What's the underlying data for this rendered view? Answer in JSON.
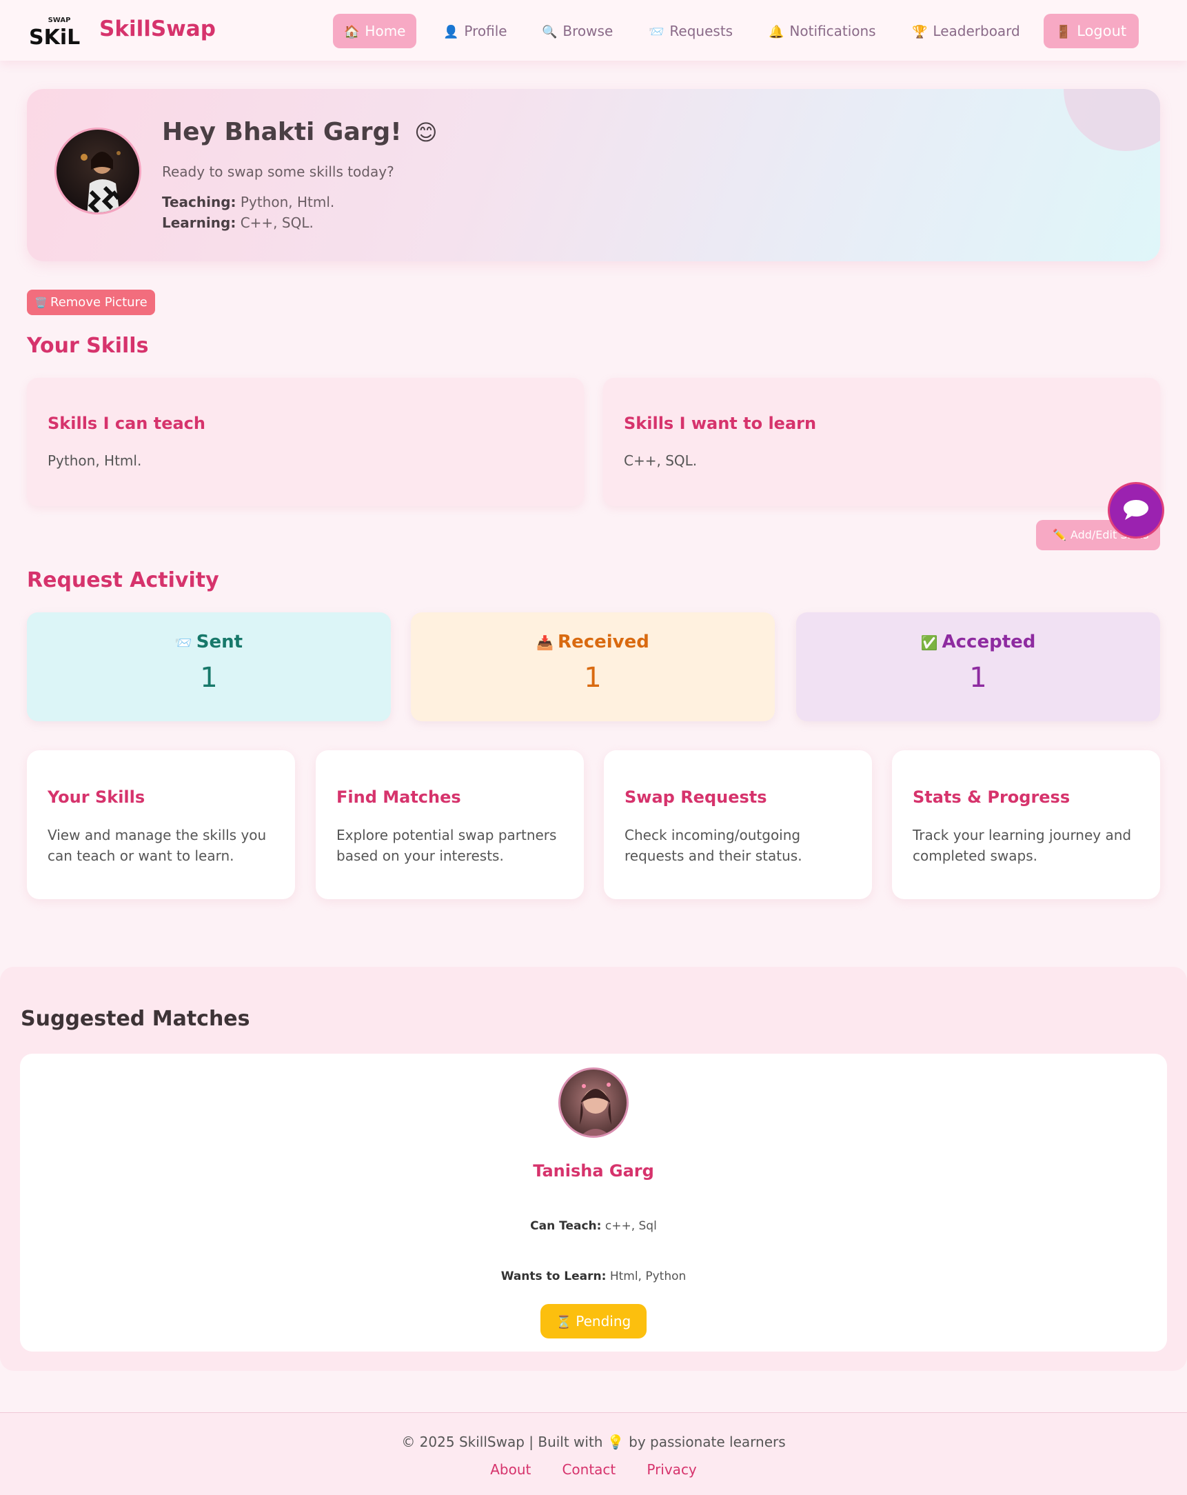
{
  "navbar": {
    "brand": "SkillSwap",
    "logo_text": "SKiL",
    "logo_swap": "SWAP",
    "items": [
      {
        "label": "Home",
        "icon": "🏠"
      },
      {
        "label": "Profile",
        "icon": "👤"
      },
      {
        "label": "Browse",
        "icon": "🔍"
      },
      {
        "label": "Requests",
        "icon": "📨"
      },
      {
        "label": "Notifications",
        "icon": "🔔"
      },
      {
        "label": "Leaderboard",
        "icon": "🏆"
      }
    ],
    "logout": {
      "label": "Logout",
      "icon": "🚪"
    }
  },
  "hero": {
    "title": "Hey Bhakti Garg!",
    "emoji": "😊",
    "subtitle": "Ready to swap some skills today?",
    "teaching_label": "Teaching:",
    "teaching_value": "Python, Html.",
    "learning_label": "Learning:",
    "learning_value": "C++, SQL."
  },
  "remove_picture": {
    "label": "Remove Picture",
    "icon": "🗑️"
  },
  "your_skills": {
    "title": "Your Skills",
    "teach_title": "Skills I can teach",
    "teach_value": "Python, Html.",
    "learn_title": "Skills I want to learn",
    "learn_value": "C++, SQL.",
    "edit_label": "Add/Edit Skills",
    "edit_icon": "✏️"
  },
  "request_activity": {
    "title": "Request Activity",
    "sent": {
      "label": "Sent",
      "icon": "📨",
      "value": "1"
    },
    "received": {
      "label": "Received",
      "icon": "📥",
      "value": "1"
    },
    "accepted": {
      "label": "Accepted",
      "icon": "✅",
      "value": "1"
    }
  },
  "features": [
    {
      "title": "Your Skills",
      "text": "View and manage the skills you can teach or want to learn."
    },
    {
      "title": "Find Matches",
      "text": "Explore potential swap partners based on your interests."
    },
    {
      "title": "Swap Requests",
      "text": "Check incoming/outgoing requests and their status."
    },
    {
      "title": "Stats & Progress",
      "text": "Track your learning journey and completed swaps."
    }
  ],
  "suggested": {
    "title": "Suggested Matches",
    "name": "Tanisha Garg",
    "can_teach_label": "Can Teach:",
    "can_teach_value": "c++, Sql",
    "wants_label": "Wants to Learn:",
    "wants_value": "Html, Python",
    "status_label": "Pending",
    "status_icon": "⏳"
  },
  "footer": {
    "text_before": "© 2025 SkillSwap | Built with",
    "icon": "💡",
    "text_after": "by passionate learners",
    "links": [
      "About",
      "Contact",
      "Privacy"
    ]
  },
  "colors": {
    "accent": "#d6336c",
    "nav_active": "#f7a9c4",
    "danger": "#f26d7d",
    "pending": "#fcbf0e",
    "chat": "#9b22b0"
  }
}
